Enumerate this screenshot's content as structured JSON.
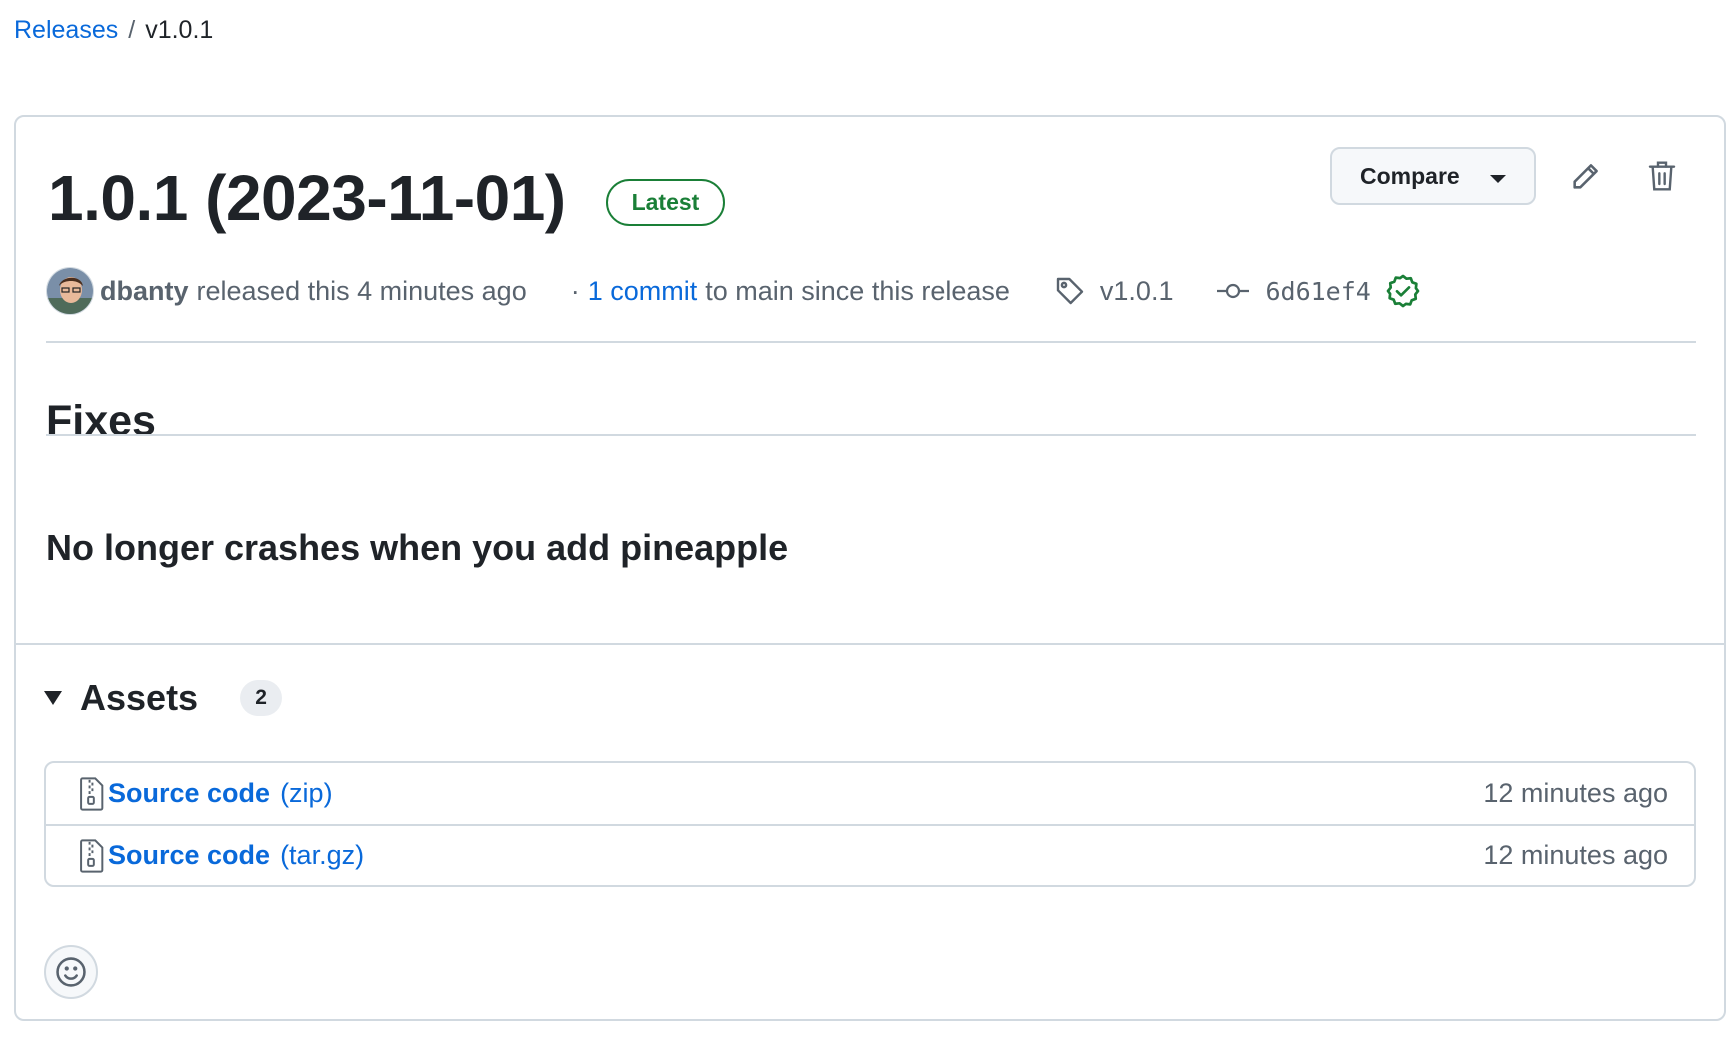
{
  "breadcrumb": {
    "parent": "Releases",
    "separator": "/",
    "current": "v1.0.1"
  },
  "release": {
    "title": "1.0.1 (2023-11-01)",
    "badge": "Latest",
    "author": "dbanty",
    "released_text": "released this 4 minutes ago",
    "dot": "·",
    "commit_link": "1 commit",
    "commit_suffix": "to main since this release",
    "tag": "v1.0.1",
    "sha": "6d61ef4"
  },
  "actions": {
    "compare_label": "Compare",
    "edit_icon": "pencil-icon",
    "delete_icon": "trash-icon"
  },
  "notes": {
    "heading": "Fixes",
    "items": [
      "No longer crashes when you add pineapple"
    ]
  },
  "assets": {
    "title": "Assets",
    "count": "2",
    "items": [
      {
        "name": "Source code",
        "ext": "(zip)",
        "time": "12 minutes ago"
      },
      {
        "name": "Source code",
        "ext": "(tar.gz)",
        "time": "12 minutes ago"
      }
    ]
  },
  "colors": {
    "link": "#0969da",
    "success": "#1a7f37",
    "border": "#d1d9e0",
    "muted": "#59636e"
  }
}
